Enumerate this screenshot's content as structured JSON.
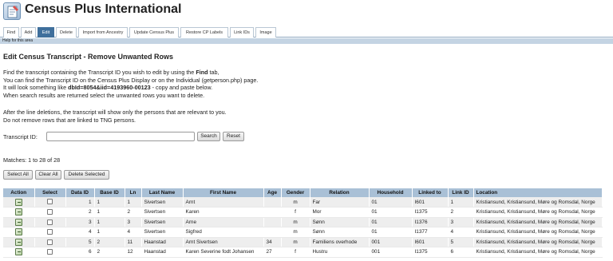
{
  "app": {
    "title": "Census Plus International"
  },
  "tabs": [
    {
      "label": "Find",
      "active": false
    },
    {
      "label": "Add",
      "active": false
    },
    {
      "label": "Edit",
      "active": true
    },
    {
      "label": "Delete",
      "active": false
    },
    {
      "label": "Import from Ancestry",
      "active": false
    },
    {
      "label": "Update Census Plus",
      "active": false
    },
    {
      "label": "Restore CP Labels",
      "active": false
    },
    {
      "label": "Link IDs",
      "active": false
    },
    {
      "label": "Image",
      "active": false
    }
  ],
  "help": {
    "text": "Help for this area"
  },
  "page": {
    "title": "Edit Census Transcript - Remove Unwanted Rows",
    "intro": {
      "line1_pre": "Find the transcript containing the Transcript ID you wish to edit by using the ",
      "line1_bold": "Find",
      "line1_post": " tab,",
      "line2": "You can find the Transcript ID on the Census Plus Display or on the Individual (getperson.php) page.",
      "line3_pre": "It will look something like ",
      "line3_bold": "dbId=8054&iid=4193960-00123",
      "line3_post": " - copy and paste below.",
      "line4": "When search results are returned select the unwanted rows you want to delete."
    },
    "note": {
      "line1": "After the line deletions, the transcript will show only the persons that are relevant to you.",
      "line2": "Do not remove rows that are linked to TNG persons."
    },
    "transcript_label": "Transcript ID:",
    "transcript_value": "",
    "search_label": "Search",
    "reset_label": "Reset",
    "matches": "Matches: 1 to 28 of 28",
    "select_all_label": "Select All",
    "clear_all_label": "Clear All",
    "delete_selected_label": "Delete Selected"
  },
  "table": {
    "columns": [
      "Action",
      "Select",
      "Data ID",
      "Base ID",
      "Ln",
      "Last Name",
      "First Name",
      "Age",
      "Gender",
      "Relation",
      "Household",
      "Linked to",
      "Link ID",
      "Location"
    ],
    "rows": [
      {
        "data_id": "1",
        "base_id": "1",
        "ln": "1",
        "last": "Sivertsen",
        "first": "Arnt",
        "age": "",
        "gender": "m",
        "relation": "Far",
        "household": "01",
        "linked": "I601",
        "link_id": "1",
        "location": "Kristiansund, Kristiansund, Møre og Romsdal, Norge"
      },
      {
        "data_id": "2",
        "base_id": "1",
        "ln": "2",
        "last": "Sivertsen",
        "first": "Karen",
        "age": "",
        "gender": "f",
        "relation": "Mor",
        "household": "01",
        "linked": "I1375",
        "link_id": "2",
        "location": "Kristiansund, Kristiansund, Møre og Romsdal, Norge"
      },
      {
        "data_id": "3",
        "base_id": "1",
        "ln": "3",
        "last": "Sivertsen",
        "first": "Arne",
        "age": "",
        "gender": "m",
        "relation": "Sønn",
        "household": "01",
        "linked": "I1376",
        "link_id": "3",
        "location": "Kristiansund, Kristiansund, Møre og Romsdal, Norge"
      },
      {
        "data_id": "4",
        "base_id": "1",
        "ln": "4",
        "last": "Sivertsen",
        "first": "Sigfred",
        "age": "",
        "gender": "m",
        "relation": "Sønn",
        "household": "01",
        "linked": "I1377",
        "link_id": "4",
        "location": "Kristiansund, Kristiansund, Møre og Romsdal, Norge"
      },
      {
        "data_id": "5",
        "base_id": "2",
        "ln": "11",
        "last": "Haanstad",
        "first": "Arnt Sivertsen",
        "age": "34",
        "gender": "m",
        "relation": "Familiens overhode",
        "household": "001",
        "linked": "I601",
        "link_id": "5",
        "location": "Kristiansund, Kristiansund, Møre og Romsdal, Norge"
      },
      {
        "data_id": "6",
        "base_id": "2",
        "ln": "12",
        "last": "Haanstad",
        "first": "Karen Severine fodt Johansen",
        "age": "27",
        "gender": "f",
        "relation": "Hustru",
        "household": "001",
        "linked": "I1375",
        "link_id": "6",
        "location": "Kristiansund, Kristiansund, Møre og Romsdal, Norge"
      }
    ]
  }
}
